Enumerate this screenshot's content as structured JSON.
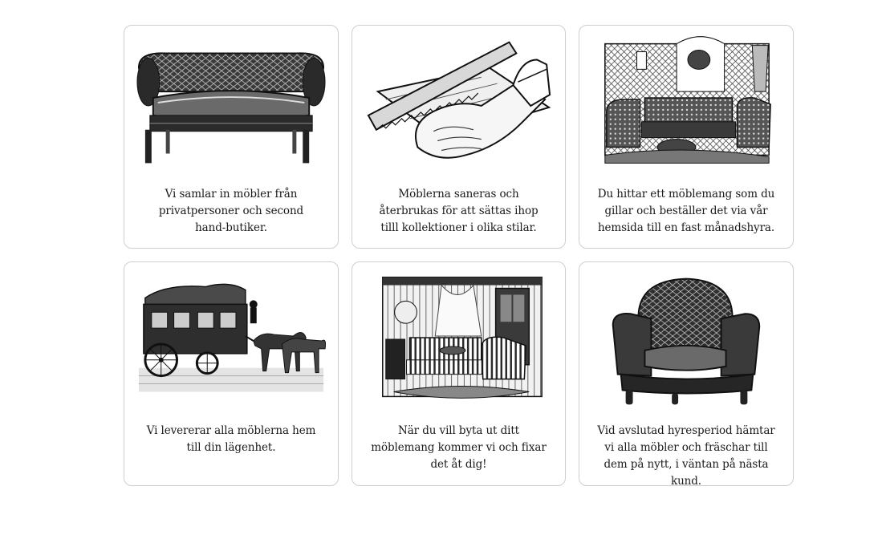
{
  "steps": [
    {
      "illustration": "sofa-illustration",
      "text": "Vi samlar in möbler från privatpersoner och second hand-butiker."
    },
    {
      "illustration": "hand-saw-illustration",
      "text": "Möblerna saneras och återbrukas för att sättas ihop tilll kollektioner i olika stilar."
    },
    {
      "illustration": "living-room-illustration",
      "text": "Du hittar ett möblemang som du gillar och beställer det via vår hemsida till en fast månadshyra."
    },
    {
      "illustration": "horse-carriage-illustration",
      "text": "Vi levererar alla möblerna hem till din lägenhet."
    },
    {
      "illustration": "striped-room-illustration",
      "text": "När du vill byta ut ditt möblemang kommer vi och fixar det åt dig!"
    },
    {
      "illustration": "armchair-illustration",
      "text": "Vid avslutad hyresperiod hämtar vi alla möbler och fräschar till dem på nytt, i väntan på nästa kund."
    }
  ]
}
